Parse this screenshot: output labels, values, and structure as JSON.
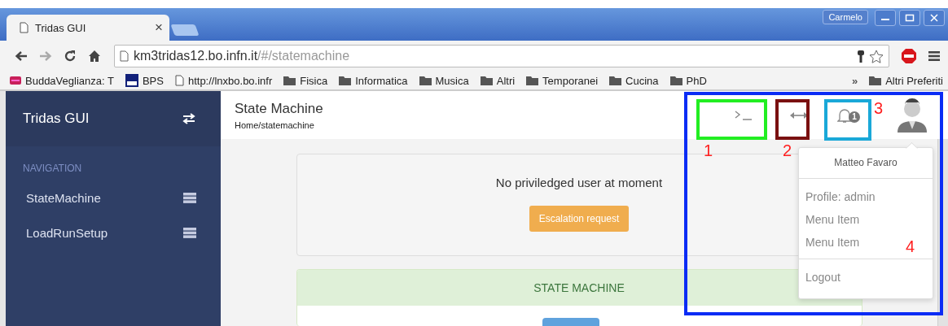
{
  "browser": {
    "tab": {
      "title": "Tridas GUI",
      "close": "×"
    },
    "profile": "Carmelo",
    "address": {
      "host": "km3tridas12.bo.infn.it",
      "path": "/#/statemachine"
    },
    "bookmarks": [
      {
        "label": "BuddaVeglianza: T",
        "kind": "site"
      },
      {
        "label": "BPS",
        "kind": "tinyurl"
      },
      {
        "label": "http://lnxbo.bo.infr",
        "kind": "page"
      },
      {
        "label": "Fisica",
        "kind": "folder"
      },
      {
        "label": "Informatica",
        "kind": "folder"
      },
      {
        "label": "Musica",
        "kind": "folder"
      },
      {
        "label": "Altri",
        "kind": "folder"
      },
      {
        "label": "Temporanei",
        "kind": "folder"
      },
      {
        "label": "Cucina",
        "kind": "folder"
      },
      {
        "label": "PhD",
        "kind": "folder"
      }
    ],
    "overflow": "»",
    "other_bookmarks": "Altri Preferiti"
  },
  "sidebar": {
    "title": "Tridas GUI",
    "section": "NAVIGATION",
    "items": [
      {
        "label": "StateMachine"
      },
      {
        "label": "LoadRunSetup"
      }
    ]
  },
  "header": {
    "title": "State Machine",
    "breadcrumb": "Home/statemachine",
    "notification_count": "1"
  },
  "user_menu": {
    "name": "Matteo Favaro",
    "items": [
      "Profile: admin",
      "Menu Item",
      "Menu Item"
    ],
    "logout": "Logout"
  },
  "privilege_card": {
    "message": "No priviledged user at moment",
    "button": "Escalation request"
  },
  "state_machine_card": {
    "title": "STATE MACHINE"
  },
  "annotations": [
    {
      "label": "1",
      "color": "#22ee22"
    },
    {
      "label": "2",
      "color": "#7a1010"
    },
    {
      "label": "3",
      "color": "#1aa8d8"
    },
    {
      "label": "4",
      "color": "#0a2cf5"
    }
  ]
}
